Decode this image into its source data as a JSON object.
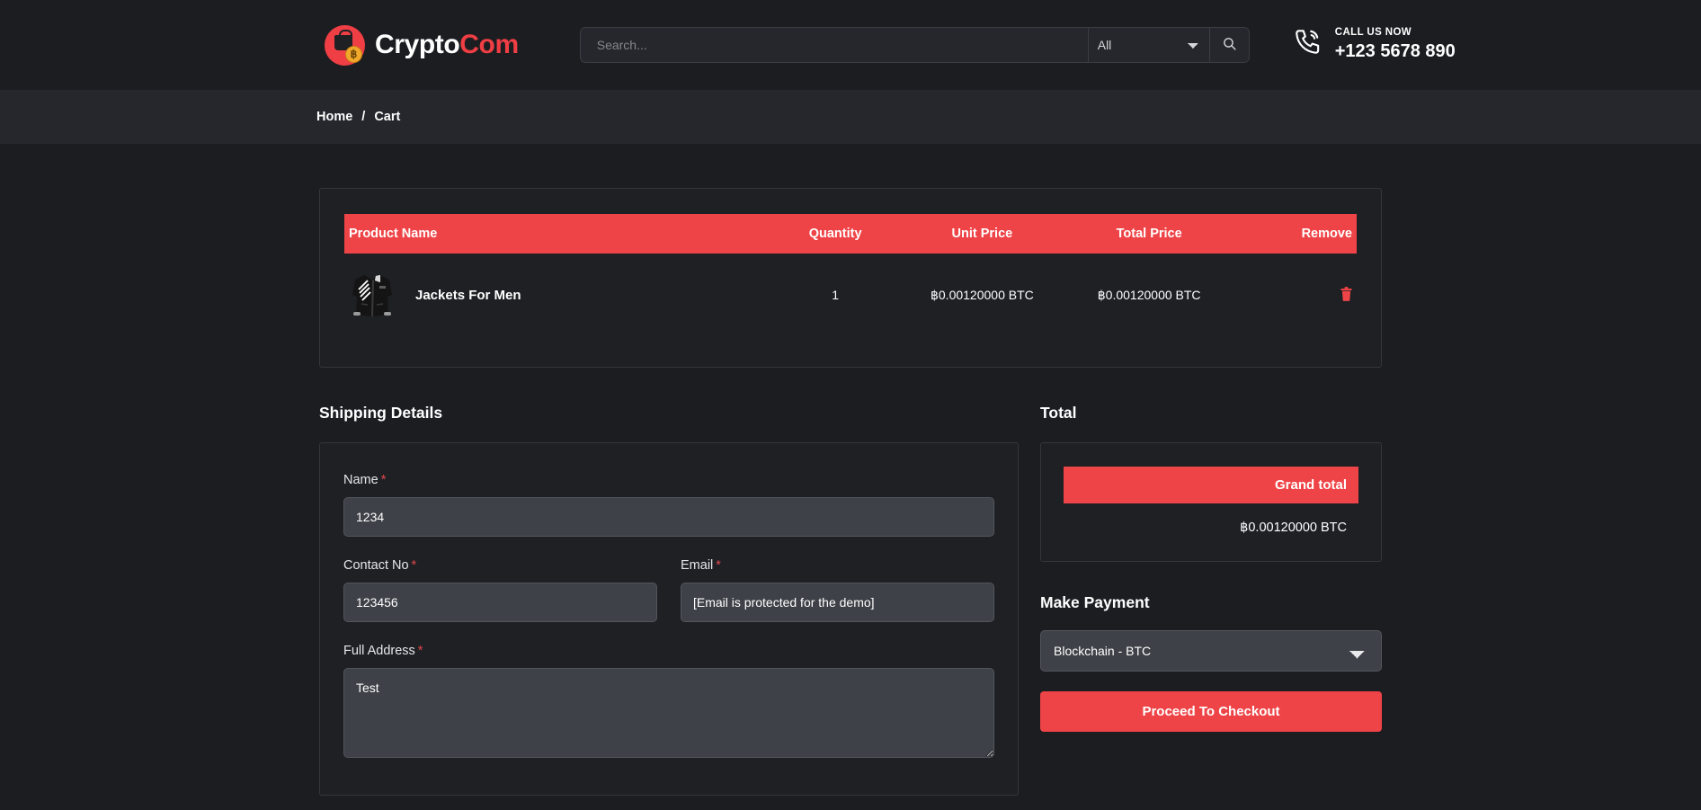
{
  "header": {
    "brand": {
      "part1": "Crypto",
      "part2": "Com",
      "coin_symbol": "฿"
    },
    "search": {
      "placeholder": "Search...",
      "value": "",
      "category_selected": "All",
      "categories": [
        "All"
      ],
      "search_icon": "search-icon"
    },
    "call": {
      "label": "CALL US NOW",
      "number": "+123 5678 890",
      "icon": "phone-ringing-icon"
    }
  },
  "breadcrumb": {
    "items": [
      "Home",
      "Cart"
    ],
    "separator": "/"
  },
  "cart": {
    "columns": [
      "Product Name",
      "Quantity",
      "Unit Price",
      "Total Price",
      "Remove"
    ],
    "rows": [
      {
        "product_name": "Jackets For Men",
        "quantity": "1",
        "unit_price": "฿0.00120000 BTC",
        "total_price": "฿0.00120000 BTC",
        "remove_icon": "trash-icon"
      }
    ]
  },
  "shipping": {
    "title": "Shipping Details",
    "required_mark": "*",
    "fields": {
      "name": {
        "label": "Name",
        "value": "1234",
        "placeholder": ""
      },
      "contact": {
        "label": "Contact No",
        "value": "123456",
        "placeholder": ""
      },
      "email": {
        "label": "Email",
        "value": "[Email is protected for the demo]",
        "placeholder": ""
      },
      "address": {
        "label": "Full Address",
        "value": "Test",
        "placeholder": ""
      }
    }
  },
  "total": {
    "title": "Total",
    "grand_total_label": "Grand total",
    "grand_total_amount": "฿0.00120000 BTC"
  },
  "payment": {
    "title": "Make Payment",
    "selected_method": "Blockchain - BTC",
    "methods": [
      "Blockchain - BTC"
    ],
    "checkout_label": "Proceed To Checkout"
  },
  "colors": {
    "accent_red": "#ef4447",
    "page_bg": "#1b1d21",
    "card_bg": "#1e2024",
    "breadcrumb_bg": "#25272c",
    "input_bg": "#3e4147",
    "coin_gold": "#f0a92b"
  }
}
